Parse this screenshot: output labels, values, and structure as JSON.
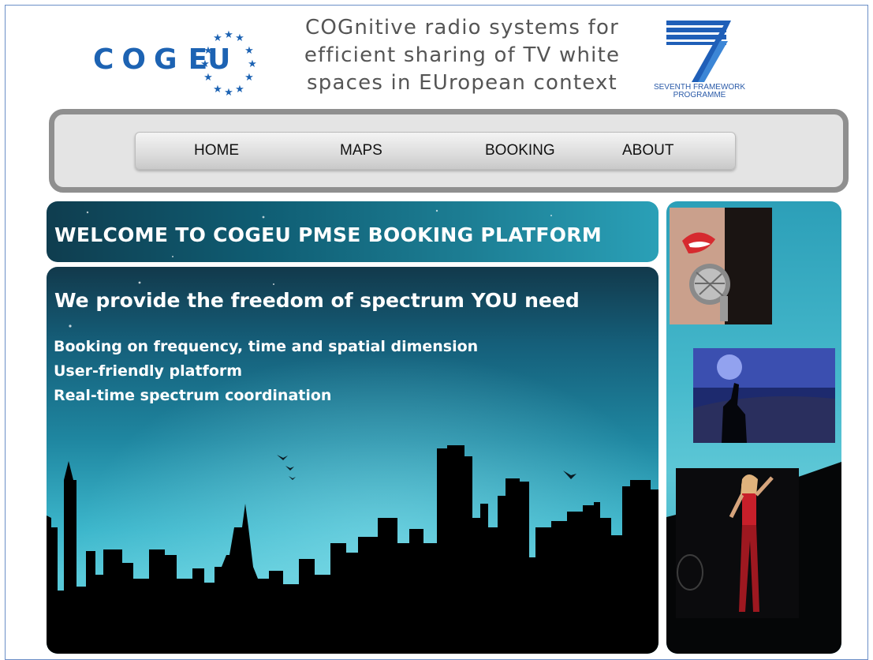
{
  "header": {
    "logo_text": "COG",
    "logo_eu": "EU",
    "headline_lines": [
      "COGnitive radio systems for",
      "efficient sharing of TV white",
      "spaces in EUropean context"
    ],
    "fp7_line1": "SEVENTH FRAMEWORK",
    "fp7_line2": "PROGRAMME",
    "fp7_number": "7"
  },
  "nav": {
    "items": [
      "HOME",
      "MAPS",
      "BOOKING",
      "ABOUT"
    ]
  },
  "welcome": {
    "title": "WELCOME TO COGEU PMSE BOOKING PLATFORM"
  },
  "main": {
    "tagline": "We provide the freedom of spectrum YOU need",
    "features": [
      "Booking on frequency, time and spatial dimension",
      "User-friendly platform",
      "Real-time spectrum coordination"
    ]
  },
  "colors": {
    "brand_blue": "#1d63b3",
    "panel_teal": "#1f87a1",
    "nav_border": "#8f8f8f"
  }
}
